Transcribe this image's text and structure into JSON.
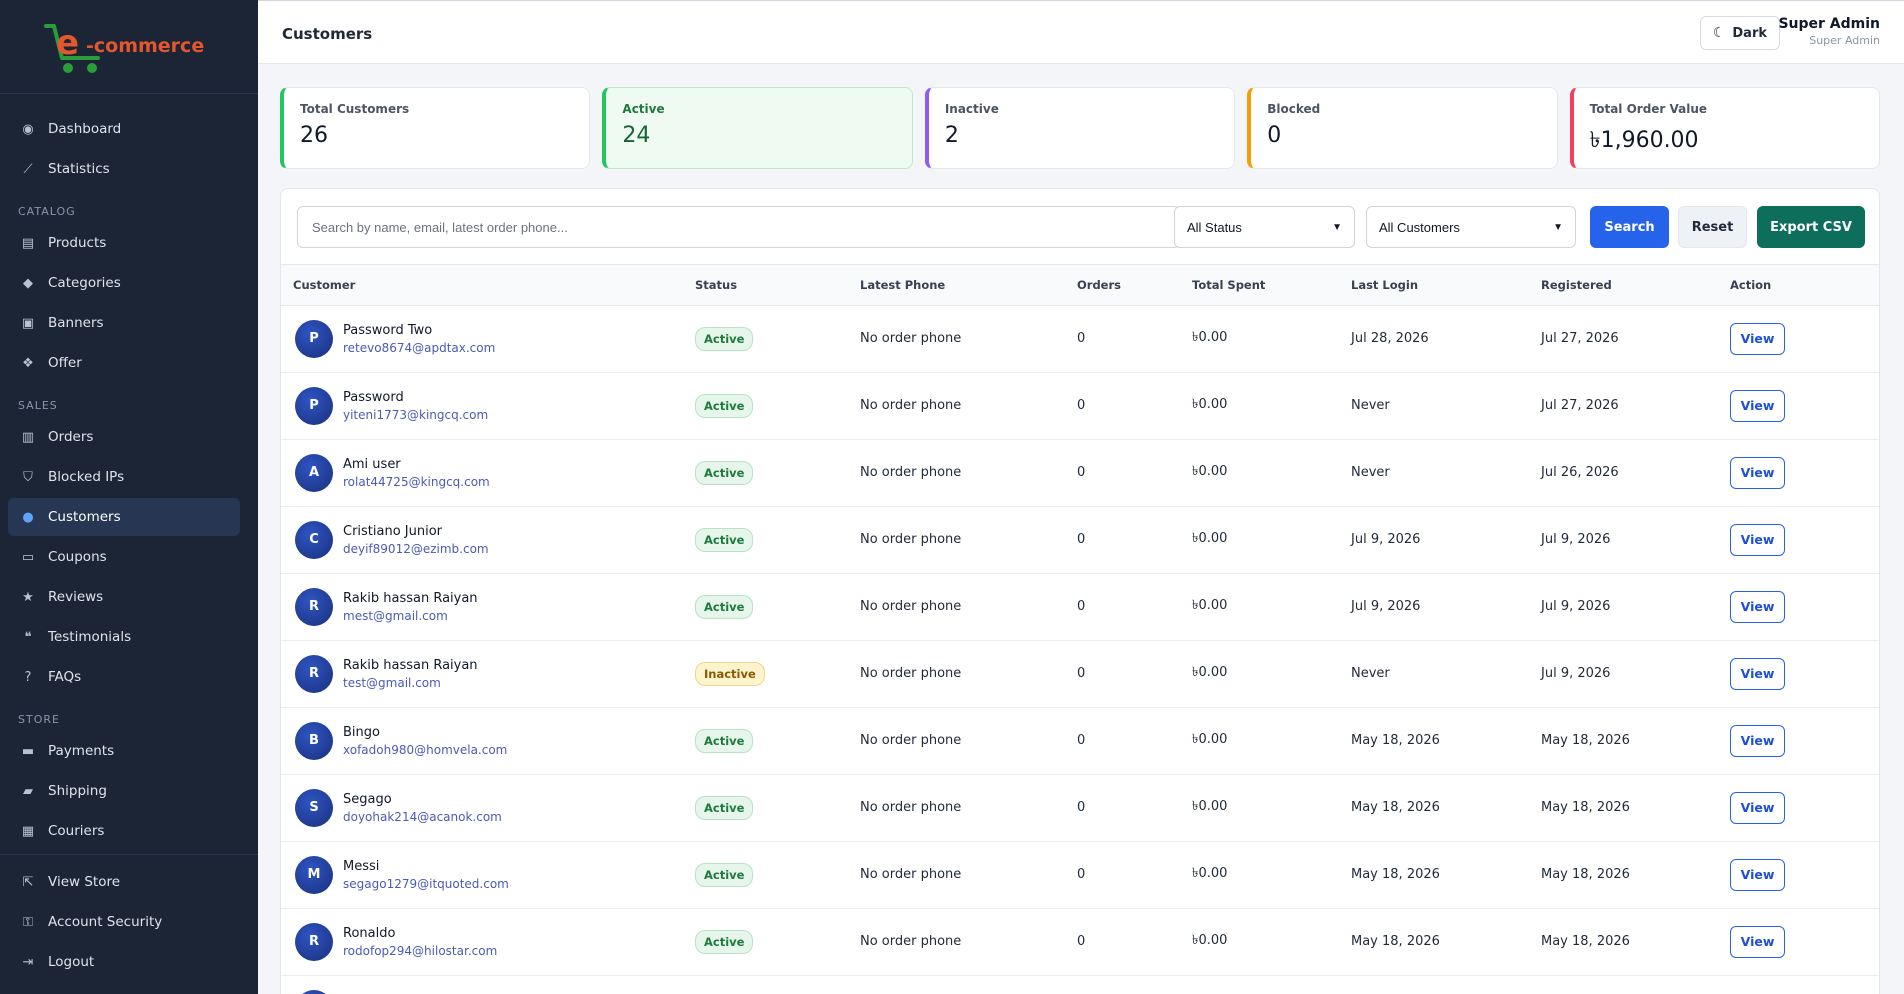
{
  "brand": {
    "logo_text": "e-commerce",
    "accent": "#e4572e",
    "cart_color": "#2a9d3a"
  },
  "sidebar": {
    "top_items": [
      {
        "label": "Dashboard",
        "icon": "dashboard-icon"
      },
      {
        "label": "Statistics",
        "icon": "chart-icon"
      }
    ],
    "sections": [
      {
        "title": "CATALOG",
        "items": [
          {
            "label": "Products",
            "icon": "box-icon"
          },
          {
            "label": "Categories",
            "icon": "tag-icon"
          },
          {
            "label": "Banners",
            "icon": "image-icon"
          },
          {
            "label": "Offer",
            "icon": "gift-icon"
          }
        ]
      },
      {
        "title": "SALES",
        "items": [
          {
            "label": "Orders",
            "icon": "receipt-icon"
          },
          {
            "label": "Blocked IPs",
            "icon": "shield-icon"
          },
          {
            "label": "Customers",
            "icon": "users-icon",
            "active": true
          },
          {
            "label": "Coupons",
            "icon": "ticket-icon"
          },
          {
            "label": "Reviews",
            "icon": "star-icon"
          },
          {
            "label": "Testimonials",
            "icon": "quote-icon"
          },
          {
            "label": "FAQs",
            "icon": "question-icon"
          }
        ]
      },
      {
        "title": "STORE",
        "items": [
          {
            "label": "Payments",
            "icon": "card-icon"
          },
          {
            "label": "Shipping",
            "icon": "truck-icon"
          },
          {
            "label": "Couriers",
            "icon": "courier-icon"
          }
        ]
      }
    ],
    "bottom_items": [
      {
        "label": "View Store",
        "icon": "external-link-icon"
      },
      {
        "label": "Account Security",
        "icon": "key-icon"
      },
      {
        "label": "Logout",
        "icon": "logout-icon"
      }
    ]
  },
  "header": {
    "title": "Customers",
    "theme_toggle": "Dark",
    "user_name": "Super Admin",
    "user_role": "Super Admin"
  },
  "stats": [
    {
      "label": "Total Customers",
      "value": "26",
      "color": "#22c55e",
      "bg": "#ffffff"
    },
    {
      "label": "Active",
      "value": "24",
      "color": "#22c55e",
      "bg": "#effbf2"
    },
    {
      "label": "Inactive",
      "value": "2",
      "color": "#8b5cf6",
      "bg": "#ffffff"
    },
    {
      "label": "Blocked",
      "value": "0",
      "color": "#f59e0b",
      "bg": "#ffffff"
    },
    {
      "label": "Total Order Value",
      "value": "৳1,960.00",
      "color": "#f43f5e",
      "bg": "#ffffff"
    }
  ],
  "toolbar": {
    "search_placeholder": "Search by name, email, latest order phone...",
    "status_filter": "All Status",
    "customer_filter": "All Customers",
    "search_label": "Search",
    "reset_label": "Reset",
    "export_label": "Export CSV"
  },
  "table": {
    "columns": [
      "Customer",
      "Status",
      "Latest Phone",
      "Orders",
      "Total Spent",
      "Last Login",
      "Registered",
      "Action"
    ],
    "action_label": "View",
    "rows": [
      {
        "initial": "P",
        "name": "Password Two",
        "email": "retevo8674@apdtax.com",
        "status": "Active",
        "phone": "No order phone",
        "orders": "0",
        "spent": "৳0.00",
        "last_login": "Jul 28, 2026",
        "registered": "Jul 27, 2026"
      },
      {
        "initial": "P",
        "name": "Password",
        "email": "yiteni1773@kingcq.com",
        "status": "Active",
        "phone": "No order phone",
        "orders": "0",
        "spent": "৳0.00",
        "last_login": "Never",
        "registered": "Jul 27, 2026"
      },
      {
        "initial": "A",
        "name": "Ami user",
        "email": "rolat44725@kingcq.com",
        "status": "Active",
        "phone": "No order phone",
        "orders": "0",
        "spent": "৳0.00",
        "last_login": "Never",
        "registered": "Jul 26, 2026"
      },
      {
        "initial": "C",
        "name": "Cristiano Junior",
        "email": "deyif89012@ezimb.com",
        "status": "Active",
        "phone": "No order phone",
        "orders": "0",
        "spent": "৳0.00",
        "last_login": "Jul 9, 2026",
        "registered": "Jul 9, 2026"
      },
      {
        "initial": "R",
        "name": "Rakib hassan Raiyan",
        "email": "mest@gmail.com",
        "status": "Active",
        "phone": "No order phone",
        "orders": "0",
        "spent": "৳0.00",
        "last_login": "Jul 9, 2026",
        "registered": "Jul 9, 2026"
      },
      {
        "initial": "R",
        "name": "Rakib hassan Raiyan",
        "email": "test@gmail.com",
        "status": "Inactive",
        "phone": "No order phone",
        "orders": "0",
        "spent": "৳0.00",
        "last_login": "Never",
        "registered": "Jul 9, 2026"
      },
      {
        "initial": "B",
        "name": "Bingo",
        "email": "xofadoh980@homvela.com",
        "status": "Active",
        "phone": "No order phone",
        "orders": "0",
        "spent": "৳0.00",
        "last_login": "May 18, 2026",
        "registered": "May 18, 2026"
      },
      {
        "initial": "S",
        "name": "Segago",
        "email": "doyohak214@acanok.com",
        "status": "Active",
        "phone": "No order phone",
        "orders": "0",
        "spent": "৳0.00",
        "last_login": "May 18, 2026",
        "registered": "May 18, 2026"
      },
      {
        "initial": "M",
        "name": "Messi",
        "email": "segago1279@itquoted.com",
        "status": "Active",
        "phone": "No order phone",
        "orders": "0",
        "spent": "৳0.00",
        "last_login": "May 18, 2026",
        "registered": "May 18, 2026"
      },
      {
        "initial": "R",
        "name": "Ronaldo",
        "email": "rodofop294@hilostar.com",
        "status": "Active",
        "phone": "No order phone",
        "orders": "0",
        "spent": "৳0.00",
        "last_login": "May 18, 2026",
        "registered": "May 18, 2026"
      },
      {
        "initial": "",
        "name": "",
        "email": "",
        "status": "",
        "phone": "",
        "orders": "",
        "spent": "",
        "last_login": "",
        "registered": ""
      }
    ]
  }
}
